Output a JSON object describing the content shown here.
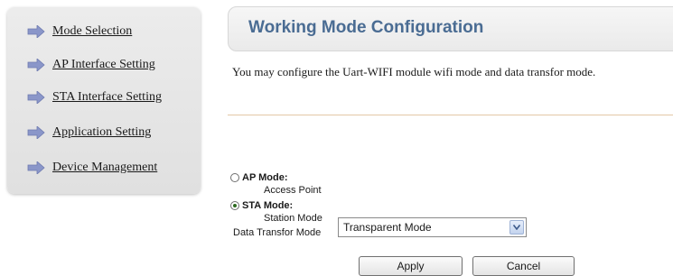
{
  "sidebar": {
    "items": [
      {
        "label": "Mode Selection",
        "icon": "arrow-right-icon"
      },
      {
        "label": "AP Interface Setting",
        "icon": "arrow-right-icon"
      },
      {
        "label": "STA Interface Setting",
        "icon": "arrow-right-icon"
      },
      {
        "label": "Application Setting",
        "icon": "arrow-right-icon"
      },
      {
        "label": "Device Management",
        "icon": "arrow-right-icon"
      }
    ]
  },
  "main": {
    "title": "Working Mode Configuration",
    "description": "You may configure the Uart-WIFI module wifi mode and data transfor mode.",
    "modes": [
      {
        "label": "AP Mode:",
        "sub": "Access Point",
        "checked": false
      },
      {
        "label": "STA Mode:",
        "sub": "Station Mode",
        "checked": true
      }
    ],
    "data_mode": {
      "label": "Data Transfor Mode",
      "value": "Transparent Mode"
    },
    "buttons": {
      "apply": "Apply",
      "cancel": "Cancel"
    }
  },
  "colors": {
    "title": "#4a6c93",
    "arrow": "#8a96c9",
    "divider": "#e3c7a6"
  }
}
